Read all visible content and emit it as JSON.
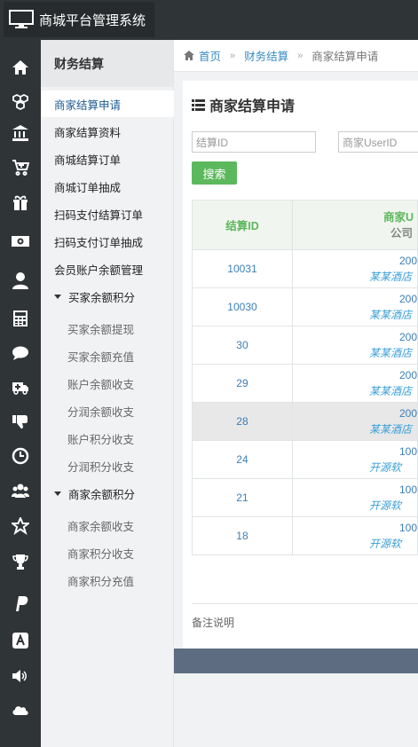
{
  "app": {
    "title": "商城平台管理系统"
  },
  "rail_icons": [
    "home-icon",
    "cubes-icon",
    "bank-icon",
    "cart-plus-icon",
    "gift-icon",
    "money-icon",
    "user-icon",
    "calculator-icon",
    "comment-icon",
    "ambulance-icon",
    "thumbs-down-icon",
    "clock-icon",
    "users-icon",
    "star-icon",
    "trophy-icon",
    "paypal-icon",
    "app-store-icon",
    "volume-icon",
    "cloud-icon"
  ],
  "submenu": {
    "header": "财务结算",
    "items": [
      {
        "label": "商家结算申请",
        "active": true
      },
      {
        "label": "商家结算资料"
      },
      {
        "label": "商城结算订单"
      },
      {
        "label": "商城订单抽成"
      },
      {
        "label": "扫码支付结算订单"
      },
      {
        "label": "扫码支付订单抽成"
      },
      {
        "label": "会员账户余额管理"
      }
    ],
    "group1": {
      "label": "买家余额积分",
      "items": [
        "买家余额提现",
        "买家余额充值",
        "账户余额收支",
        "分润余额收支",
        "账户积分收支",
        "分润积分收支"
      ]
    },
    "group2": {
      "label": "商家余额积分",
      "items": [
        "商家余额收支",
        "商家积分收支",
        "商家积分充值"
      ]
    }
  },
  "breadcrumb": {
    "home": "首页",
    "section": "财务结算",
    "current": "商家结算申请"
  },
  "panel": {
    "title": "商家结算申请",
    "search_id_placeholder": "结算ID",
    "search_user_placeholder": "商家UserID",
    "search_button": "搜索",
    "col_id": "结算ID",
    "col_user": "商家U",
    "col_user_sub": "公司",
    "note": "备注说明"
  },
  "rows": [
    {
      "id": "10031",
      "num": "200",
      "company": "某某酒店"
    },
    {
      "id": "10030",
      "num": "200",
      "company": "某某酒店"
    },
    {
      "id": "30",
      "num": "200",
      "company": "某某酒店"
    },
    {
      "id": "29",
      "num": "200",
      "company": "某某酒店"
    },
    {
      "id": "28",
      "num": "200",
      "company": "某某酒店",
      "highlight": true
    },
    {
      "id": "24",
      "num": "100",
      "company": "开源软"
    },
    {
      "id": "21",
      "num": "100",
      "company": "开源软"
    },
    {
      "id": "18",
      "num": "100",
      "company": "开源软"
    }
  ],
  "colors": {
    "accent_green": "#5cb85c",
    "link_blue": "#3a8cc4",
    "dark_bg": "#2f3437"
  }
}
